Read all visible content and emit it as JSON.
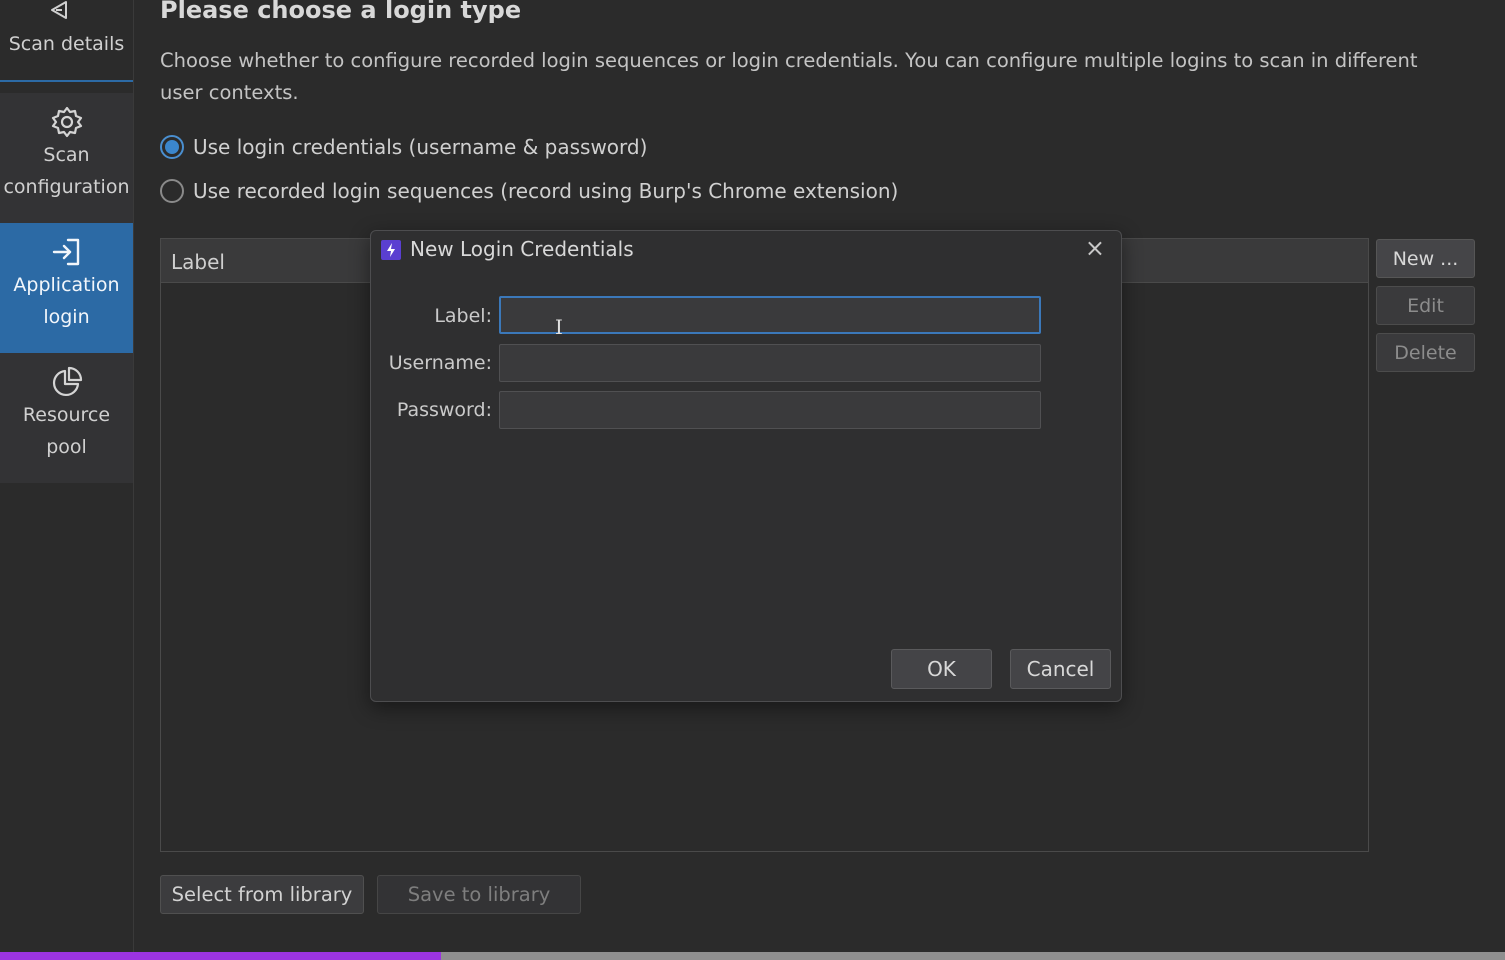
{
  "sidebar": {
    "items": [
      {
        "label": "Scan details",
        "icon": "back-arrow-icon"
      },
      {
        "label": "Scan configuration",
        "icon": "gear-icon"
      },
      {
        "label": "Application login",
        "icon": "login-arrow-icon",
        "active": true
      },
      {
        "label": "Resource pool",
        "icon": "pie-chart-icon"
      }
    ]
  },
  "main": {
    "title": "Please choose a login type",
    "description": "Choose whether to configure recorded login sequences or login credentials. You can configure multiple logins to scan in different user contexts.",
    "radio_options": [
      {
        "label": "Use login credentials (username & password)",
        "checked": true
      },
      {
        "label": "Use recorded login sequences (record using Burp's Chrome extension)",
        "checked": false
      }
    ],
    "table": {
      "columns": [
        "Label"
      ],
      "rows": []
    },
    "side_buttons": {
      "new": "New ...",
      "edit": "Edit",
      "delete": "Delete"
    },
    "bottom_buttons": {
      "select": "Select from library",
      "save": "Save to library"
    }
  },
  "dialog": {
    "title": "New Login Credentials",
    "close_icon": "×",
    "fields": {
      "label": {
        "label": "Label:",
        "value": ""
      },
      "username": {
        "label": "Username:",
        "value": ""
      },
      "password": {
        "label": "Password:",
        "value": ""
      }
    },
    "ok": "OK",
    "cancel": "Cancel"
  },
  "progress": {
    "fraction": 0.293
  },
  "colors": {
    "accent": "#2c6aa5",
    "progress": "#9b34e0",
    "burp_logo": "#5a3fd1"
  }
}
